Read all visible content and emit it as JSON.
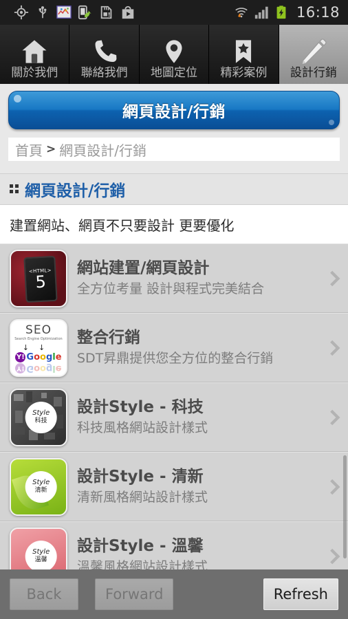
{
  "statusbar": {
    "time": "16:18",
    "left_icons": [
      "gps-icon",
      "usb-icon",
      "app-icon",
      "phone-share-icon",
      "sdcard-icon",
      "play-store-icon"
    ],
    "right_icons": [
      "wifi-download-icon",
      "signal-bars-icon",
      "battery-charging-icon"
    ]
  },
  "tabs": [
    {
      "label": "關於我們",
      "icon": "home-icon",
      "active": false
    },
    {
      "label": "聯絡我們",
      "icon": "phone-icon",
      "active": false
    },
    {
      "label": "地圖定位",
      "icon": "location-pin-icon",
      "active": false
    },
    {
      "label": "精彩案例",
      "icon": "bookmark-star-icon",
      "active": false
    },
    {
      "label": "設計行銷",
      "icon": "pencil-icon",
      "active": true
    }
  ],
  "page": {
    "title_button": "網頁設計/行銷",
    "breadcrumb": {
      "home": "首頁",
      "separator": ">",
      "current": "網頁設計/行銷"
    },
    "section_title": "網頁設計/行銷",
    "tagline": "建置網站、網頁不只要設計 更要優化"
  },
  "list": [
    {
      "title": "網站建置/網頁設計",
      "subtitle": "全方位考量 設計與程式完美結合",
      "thumb": "html5-tablet-thumbnail",
      "thumb_text": {
        "tag": "<HTML>",
        "num": "5"
      }
    },
    {
      "title": "整合行銷",
      "subtitle": "SDT昇鼎提供您全方位的整合行銷",
      "thumb": "seo-search-engines-thumbnail",
      "thumb_text": {
        "seo": "SEO",
        "seo_sub": "Search Engine Optimization",
        "yahoo": "Y!",
        "google": "Google"
      }
    },
    {
      "title": "設計Style - 科技",
      "subtitle": "科技風格網站設計樣式",
      "thumb": "tech-style-thumbnail",
      "thumb_text": {
        "style": "Style",
        "kind": "科技"
      }
    },
    {
      "title": "設計Style - 清新",
      "subtitle": "清新風格網站設計樣式",
      "thumb": "fresh-leaf-style-thumbnail",
      "thumb_text": {
        "style": "Style",
        "kind": "清新"
      }
    },
    {
      "title": "設計Style - 溫馨",
      "subtitle": "溫馨風格網站設計樣式",
      "thumb": "warm-style-thumbnail",
      "thumb_text": {
        "style": "Style",
        "kind": "溫馨"
      }
    }
  ],
  "bottombar": {
    "back": "Back",
    "forward": "Forward",
    "refresh": "Refresh"
  },
  "colors": {
    "accent_blue": "#1878c4",
    "section_title_blue": "#1f5fa8",
    "status_bar": "#1d1d1d",
    "bottom_bar": "#6e6e6e",
    "battery_green": "#8fc31f"
  }
}
